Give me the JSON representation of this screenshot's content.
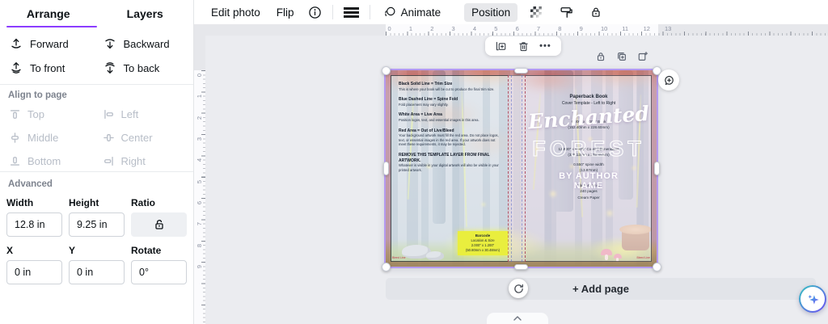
{
  "colors": {
    "accent_purple": "#8b3dff",
    "selection_outline": "#b49af0",
    "barcode_yellow": "#e9ee3e"
  },
  "sidebar": {
    "tabs": {
      "arrange": "Arrange",
      "layers": "Layers"
    },
    "arrange": {
      "forward": "Forward",
      "backward": "Backward",
      "to_front": "To front",
      "to_back": "To back"
    },
    "align": {
      "title": "Align to page",
      "top": "Top",
      "left": "Left",
      "middle": "Middle",
      "center": "Center",
      "bottom": "Bottom",
      "right": "Right"
    },
    "advanced": {
      "title": "Advanced",
      "width_label": "Width",
      "width_value": "12.8 in",
      "height_label": "Height",
      "height_value": "9.25 in",
      "ratio_label": "Ratio",
      "x_label": "X",
      "x_value": "0 in",
      "y_label": "Y",
      "y_value": "0 in",
      "rotate_label": "Rotate",
      "rotate_value": "0°"
    }
  },
  "toolbar": {
    "edit_photo": "Edit photo",
    "flip": "Flip",
    "animate": "Animate",
    "position": "Position"
  },
  "page_toolbar": {
    "more": "•••"
  },
  "rulers": {
    "horizontal": [
      "0",
      "1",
      "2",
      "3",
      "4",
      "5",
      "6",
      "7",
      "8",
      "9",
      "10",
      "11",
      "12",
      "13"
    ],
    "vertical": [
      "0",
      "1",
      "2",
      "3",
      "4",
      "5",
      "6",
      "7",
      "8",
      "9"
    ]
  },
  "cover": {
    "instructions": [
      {
        "h": "Black Solid Line = Trim Size",
        "b": "This is where your book will be cut to produce the final trim size."
      },
      {
        "h": "Blue Dashed Line = Spine Fold",
        "b": "Fold placement may vary slightly."
      },
      {
        "h": "White Area = Live Area",
        "b": "Position logos, text, and essential images in this area."
      },
      {
        "h": "Red Area = Out of Live/Bleed",
        "b": "Your background artwork must fill the red area. Do not place logos, text, or essential images in the red area. If your artwork does not meet these requirements, it may be rejected."
      },
      {
        "h": "REMOVE THIS TEMPLATE LAYER FROM FINAL ARTWORK.",
        "b": "Whatever is visible in your digital artwork will also be visible in your printed artwork."
      }
    ],
    "barcode": {
      "title": "Barcode",
      "subtitle": "Location & Size",
      "size_in": "2.000\" x 1.200\"",
      "size_mm": "(50.80mm x 30.48mm)"
    },
    "front": {
      "tpl_title": "Paperback Book",
      "tpl_sub": "Cover Template - Left to Right",
      "title_script": "Enchanted",
      "title_caps": "FOREST",
      "byline_1": "BY AUTHOR",
      "byline_2": "NAME",
      "spec_a": [
        "6.000\" x 9.000\" Book",
        "(152.40mm x 228.60mm)"
      ],
      "spec_b": [
        "12.800\" x 9.250\" Cover | Dimensions",
        "(325.12mm x 234.95mm)"
      ],
      "spec_c": [
        "0.550\" spine width",
        "(13.97mm)"
      ],
      "spec_d": [
        "Black & White",
        "240 pages",
        "Cream Paper"
      ]
    },
    "corner_note": "Bleed Line"
  },
  "canvas": {
    "add_page": "+ Add page"
  }
}
